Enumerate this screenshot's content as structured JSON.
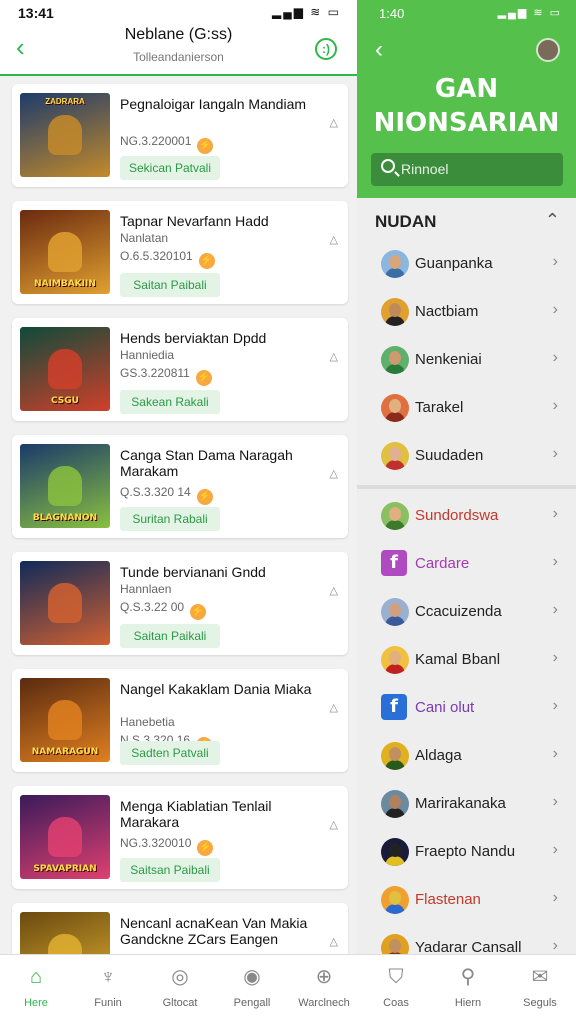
{
  "left_status": {
    "time": "13:41",
    "icons": "▂▄▆ ≋ ▭"
  },
  "left_header": {
    "title": "Neblane (G:ss)",
    "subtitle": "Tolleandanierson",
    "back_icon": "chevron-left-icon",
    "face_icon": "smiley-icon"
  },
  "cards": [
    {
      "title": "Pegnaloigar Iangaln Mandiam",
      "sub": "",
      "code": "NG.3.220001",
      "button": "Sekican Patvali",
      "art_top": "ZADRARA",
      "art_bottom": "",
      "colors": [
        "#1d3b6b",
        "#c48a2a"
      ]
    },
    {
      "title": "Tapnar Nevarfann Hadd",
      "sub": "Nanlatan",
      "code": "O.6.5.320101",
      "button": "Saitan Paibali",
      "art_top": "",
      "art_bottom": "NAIMBAKIIN",
      "colors": [
        "#6b2a10",
        "#e0a030"
      ]
    },
    {
      "title": "Hends berviaktan Dpdd",
      "sub": "Hanniedia",
      "code": "GS.3.220811",
      "button": "Sakean Rakali",
      "art_top": "",
      "art_bottom": "CSGU",
      "colors": [
        "#0f4a3a",
        "#d0402a"
      ]
    },
    {
      "title": "Canga Stan Dama Naragah Marakam",
      "sub": "",
      "code": "Q.S.3.320 14",
      "button": "Suritan Rabali",
      "art_top": "",
      "art_bottom": "BLAGNANON",
      "colors": [
        "#1a3a6a",
        "#8ac040"
      ]
    },
    {
      "title": "Tunde bervianani Gndd",
      "sub": "Hannlaen",
      "code": "Q.S.3.22 00",
      "button": "Saitan Paikali",
      "art_top": "",
      "art_bottom": "",
      "colors": [
        "#102a5a",
        "#d06030"
      ]
    },
    {
      "title": "Nangel Kakaklam Dania Miaka",
      "sub": "Hanebetia",
      "code": "N.S.3.320 16",
      "button": "Sadten Patvali",
      "art_top": "",
      "art_bottom": "NAMARAGUN",
      "colors": [
        "#5a2a10",
        "#e08020"
      ]
    },
    {
      "title": "Menga Kiablatian Tenlail Marakara",
      "sub": "",
      "code": "NG.3.320010",
      "button": "Saitsan Paibali",
      "art_top": "",
      "art_bottom": "SPAVAPRIAN",
      "colors": [
        "#3a1a5a",
        "#e04070"
      ]
    },
    {
      "title": "Nencanl acnaKean Van Makia Gandckne ZCars Eangen",
      "sub": "",
      "code": "",
      "button": "",
      "art_top": "",
      "art_bottom": "",
      "colors": [
        "#6a4a10",
        "#e0b030"
      ]
    }
  ],
  "nav": [
    {
      "label": "Here",
      "icon": "home-icon",
      "glyph": "⌂",
      "active": true
    },
    {
      "label": "Funin",
      "icon": "dragon-icon",
      "glyph": "♆",
      "active": false
    },
    {
      "label": "Gltocat",
      "icon": "circle-icon",
      "glyph": "◎",
      "active": false
    },
    {
      "label": "Pengall",
      "icon": "drop-icon",
      "glyph": "◉",
      "active": false
    },
    {
      "label": "Warclnech",
      "icon": "shield-icon",
      "glyph": "⊕",
      "active": false
    },
    {
      "label": "Coas",
      "icon": "helmet-icon",
      "glyph": "⛉",
      "active": false
    },
    {
      "label": "Hiern",
      "icon": "search-icon",
      "glyph": "⚲",
      "active": false
    },
    {
      "label": "Seguls",
      "icon": "chat-icon",
      "glyph": "✉",
      "active": false
    }
  ],
  "right_status": {
    "time": "1:40",
    "icons": "▂▄▆ ≋ ▭"
  },
  "right_header": {
    "title_line1": "GAN",
    "title_line2": "NIONSARIAN"
  },
  "search": {
    "placeholder": "Rinnoel"
  },
  "section": {
    "title": "NUDAN"
  },
  "group1": [
    {
      "label": "Guanpanka",
      "color": "#222",
      "head": "#d9a57a",
      "body": "#3a6ea5",
      "bg": "#8ab6e0"
    },
    {
      "label": "Nactbiam",
      "color": "#222",
      "head": "#c08a5a",
      "body": "#222",
      "bg": "#e0a030"
    },
    {
      "label": "Nenkeniai",
      "color": "#222",
      "head": "#d09a70",
      "body": "#2a7a3a",
      "bg": "#5fb06a"
    },
    {
      "label": "Tarakel",
      "color": "#222",
      "head": "#e0b080",
      "body": "#8a2a1a",
      "bg": "#e07040"
    },
    {
      "label": "Suudaden",
      "color": "#222",
      "head": "#e0b090",
      "body": "#c03030",
      "bg": "#e0c040"
    }
  ],
  "group2": [
    {
      "label": "Sundordswa",
      "color": "#c0392b",
      "kind": "avatar",
      "head": "#e0b080",
      "body": "#3a7a2a",
      "bg": "#8ac060"
    },
    {
      "label": "Cardare",
      "color": "#a23bb0",
      "kind": "fb",
      "bg": "#b04ac0"
    },
    {
      "label": "Ccacuizenda",
      "color": "#222",
      "kind": "avatar",
      "head": "#d0a080",
      "body": "#3a5a9a",
      "bg": "#9ab0d0"
    },
    {
      "label": "Kamal Bbanl",
      "color": "#222",
      "kind": "avatar",
      "head": "#e0b080",
      "body": "#c02020",
      "bg": "#f0c040"
    },
    {
      "label": "Cani olut",
      "color": "#7a3ab0",
      "kind": "fb",
      "bg": "#2a6ed8"
    },
    {
      "label": "Aldaga",
      "color": "#222",
      "kind": "avatar",
      "head": "#c09060",
      "body": "#2a5a1a",
      "bg": "#e0b020"
    },
    {
      "label": "Marirakanaka",
      "color": "#222",
      "kind": "avatar",
      "head": "#b08060",
      "body": "#222",
      "bg": "#6a8aa0"
    },
    {
      "label": "Fraepto Nandu",
      "color": "#222",
      "kind": "avatar",
      "head": "#222",
      "body": "#e0c020",
      "bg": "#1a1a3a"
    },
    {
      "label": "Flastenan",
      "color": "#c0392b",
      "kind": "avatar",
      "head": "#e0c040",
      "body": "#2a6ad0",
      "bg": "#f0a030"
    },
    {
      "label": "Yadarar Cansall",
      "color": "#222",
      "kind": "avatar",
      "head": "#c09060",
      "body": "#8a2a1a",
      "bg": "#e0a020"
    }
  ],
  "accent": "#2db84c"
}
